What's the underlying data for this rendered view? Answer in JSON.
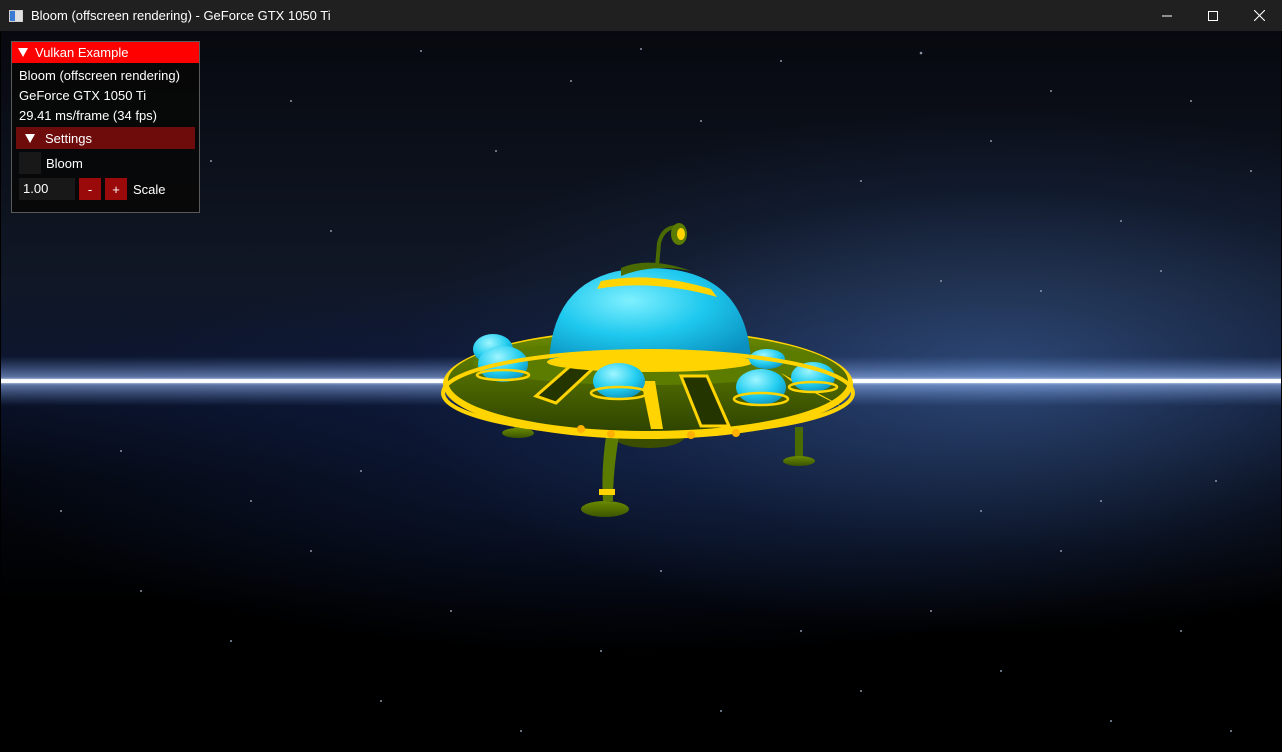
{
  "window": {
    "title": "Bloom (offscreen rendering) - GeForce GTX 1050 Ti",
    "icon": "app-window-icon",
    "controls": {
      "minimize_icon": "minimize-icon",
      "maximize_icon": "maximize-icon",
      "close_icon": "close-icon"
    }
  },
  "overlay": {
    "header_title": "Vulkan Example",
    "header_color": "#ff0000",
    "example_name": "Bloom (offscreen rendering)",
    "device_name": "GeForce GTX 1050 Ti",
    "frame_stats": "29.41 ms/frame (34 fps)",
    "settings": {
      "header_label": "Settings",
      "header_color": "#6e0c0c",
      "bloom_label": "Bloom",
      "bloom_checked": false,
      "scale_value": "1.00",
      "decrement_label": "-",
      "increment_label": "+",
      "scale_label": "Scale",
      "button_color": "#9a0a0a"
    }
  },
  "scene": {
    "description_icon": "ufo-model",
    "hull_color": "#4a6b00",
    "trim_color": "#ffd400",
    "dome_color": "#1ec8ee",
    "bloom_streak_color": "#cfe4ff"
  }
}
